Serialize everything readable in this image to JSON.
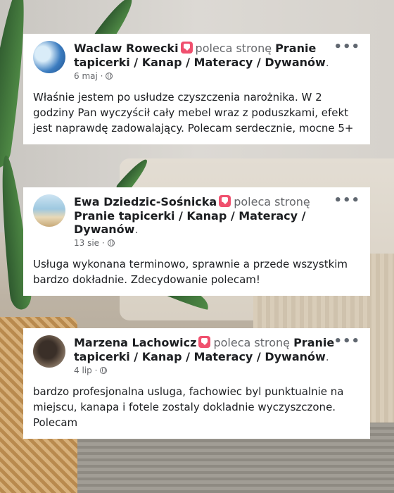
{
  "reviews": [
    {
      "author": "Waclaw Rowecki",
      "action": "poleca stronę",
      "page": "Pranie tapicerki / Kanap / Materacy / Dywanów",
      "date": "6 maj",
      "text": "Właśnie jestem po usłudze czyszczenia narożnika. W 2 godziny Pan wyczyścił cały mebel wraz z poduszkami, efekt jest naprawdę zadowalający. Polecam serdecznie, mocne 5+"
    },
    {
      "author": "Ewa Dziedzic-Sośnicka",
      "action": "poleca stronę",
      "page": "Pranie tapicerki / Kanap / Materacy / Dywanów",
      "date": "13 sie",
      "text": "Usługa wykonana terminowo, sprawnie a przede wszystkim bardzo dokładnie.  Zdecydowanie polecam!"
    },
    {
      "author": "Marzena Lachowicz",
      "action": "poleca stronę",
      "page": "Pranie tapicerki / Kanap / Materacy / Dywanów",
      "date": "4 lip",
      "text": "bardzo profesjonalna usluga, fachowiec byl punktualnie na miejscu, kanapa i fotele zostaly dokladnie wyczyszczone. Polecam"
    }
  ],
  "ui": {
    "more_glyph": "•••",
    "meta_separator": "·",
    "period": ".",
    "recommend_badge_color": "#f0506e"
  }
}
